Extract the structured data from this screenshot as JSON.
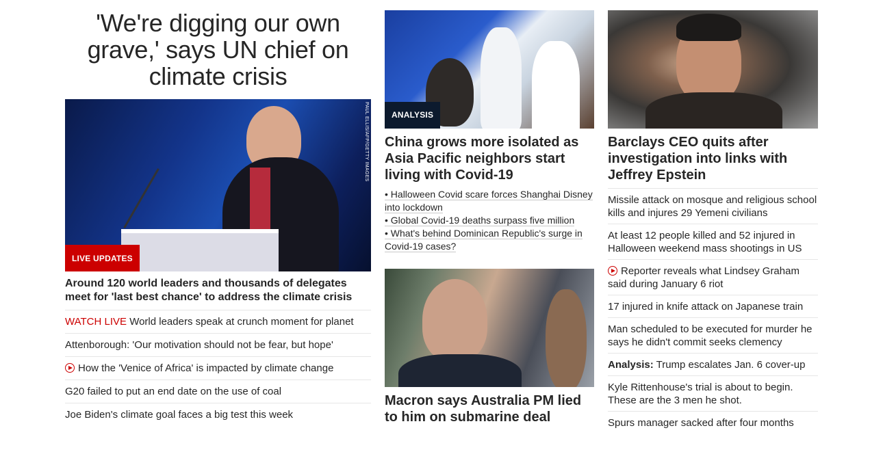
{
  "left": {
    "headline": "'We're digging our own grave,' says UN chief on climate crisis",
    "image_credit": "PAUL ELLIS/AFP/GETTY IMAGES",
    "badge": "LIVE UPDATES",
    "subheadline": "Around 120 world leaders and thousands of delegates meet for 'last best chance' to address the climate crisis",
    "list": [
      {
        "prefix": "WATCH LIVE",
        "text": "World leaders speak at crunch moment for planet"
      },
      {
        "text": "Attenborough: 'Our motivation should not be fear, but hope'"
      },
      {
        "icon": "play-icon",
        "text": "How the 'Venice of Africa' is impacted by climate change"
      },
      {
        "text": "G20 failed to put an end date on the use of coal"
      },
      {
        "text": "Joe Biden's climate goal faces a big test this week"
      }
    ]
  },
  "middle": {
    "badge": "ANALYSIS",
    "headline": "China grows more isolated as Asia Pacific neighbors start living with Covid-19",
    "bullets": [
      "• Halloween Covid scare forces Shanghai Disney into lockdown",
      "• Global Covid-19 deaths surpass five million",
      "• What's behind Dominican Republic's surge in Covid-19 cases?"
    ],
    "headline2": "Macron says Australia PM lied to him on submarine deal"
  },
  "right": {
    "headline": "Barclays CEO quits after investigation into links with Jeffrey Epstein",
    "list": [
      {
        "text": "Missile attack on mosque and religious school kills and injures 29 Yemeni civilians"
      },
      {
        "text": "At least 12 people killed and 52 injured in Halloween weekend mass shootings in US"
      },
      {
        "icon": "play-icon",
        "text": "Reporter reveals what Lindsey Graham said during January 6 riot"
      },
      {
        "text": "17 injured in knife attack on Japanese train"
      },
      {
        "text": "Man scheduled to be executed for murder he says he didn't commit seeks clemency"
      },
      {
        "prefix": "Analysis:",
        "text": "Trump escalates Jan. 6 cover-up"
      },
      {
        "text": "Kyle Rittenhouse's trial is about to begin. These are the 3 men he shot."
      },
      {
        "text": "Spurs manager sacked after four months"
      }
    ]
  },
  "colors": {
    "accent_red": "#cc0000",
    "analysis_badge": "#0c1a2e",
    "text": "#262626",
    "divider": "#e6e6e6"
  }
}
